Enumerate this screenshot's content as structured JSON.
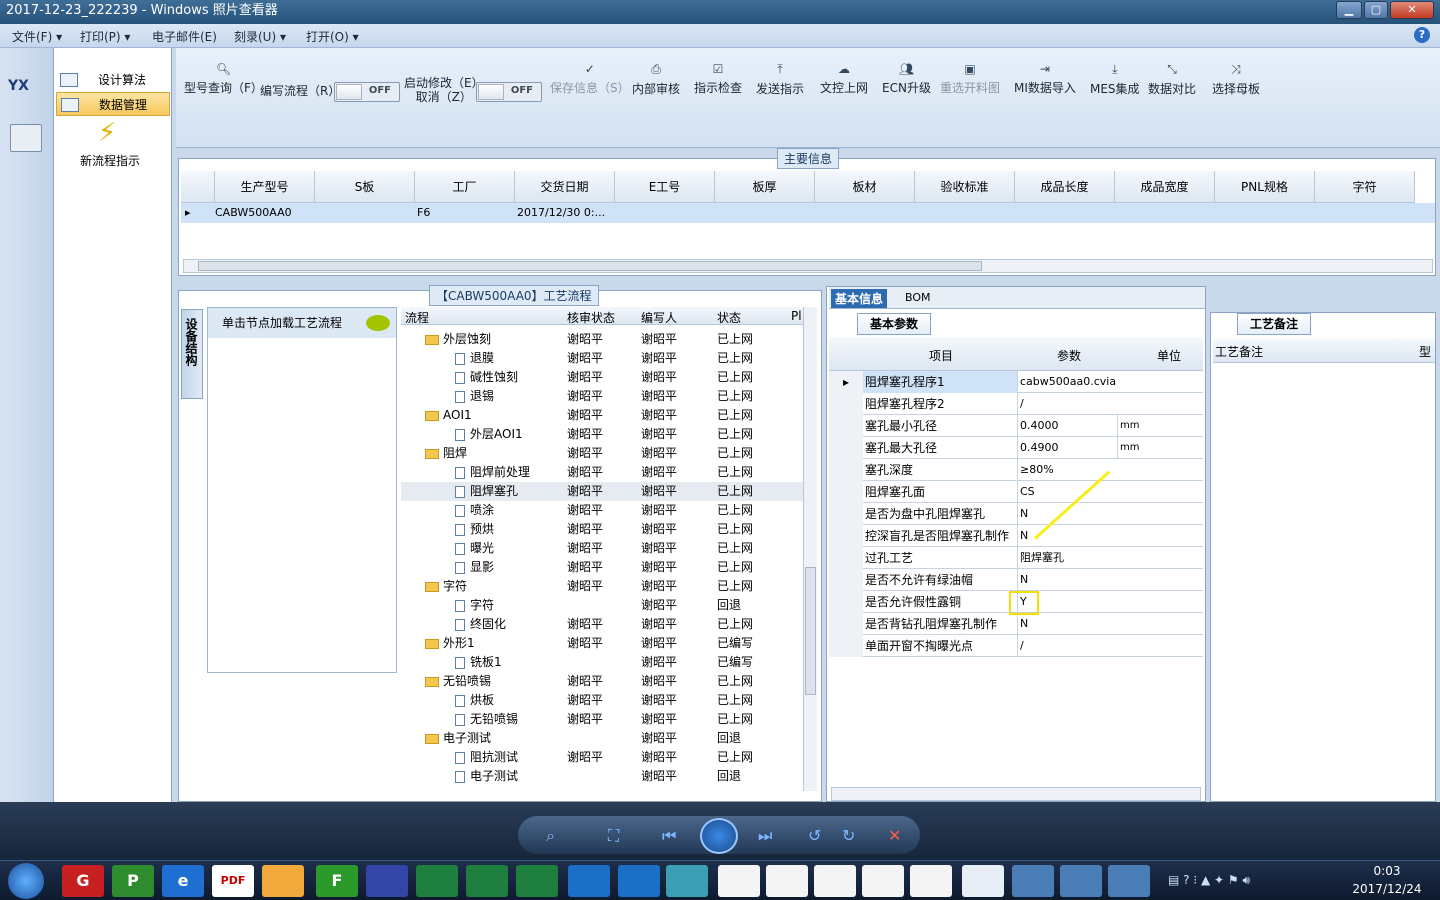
{
  "window": {
    "title": "2017-12-23_222239 - Windows 照片查看器",
    "min": "▁",
    "max": "▢",
    "close": "✕"
  },
  "menubar": {
    "items": [
      "文件(F) ▾",
      "打印(P) ▾",
      "电子邮件(E)",
      "刻录(U) ▾",
      "打开(O) ▾"
    ],
    "help": "?"
  },
  "left": {
    "logo": "YX"
  },
  "nav": {
    "items": [
      "设计算法",
      "数据管理"
    ],
    "action": "新流程指示"
  },
  "ribbon": {
    "buttons": [
      "型号查询（F）",
      "编写流程（R）",
      "启动修改（E）",
      "取消（Z）",
      "保存信息（S）",
      "内部审核",
      "指示检查",
      "发送指示",
      "文控上网",
      "ECN升级",
      "重选开料图",
      "MI数据导入",
      "MES集成",
      "数据对比",
      "选择母板"
    ],
    "toggle": "OFF"
  },
  "main": {
    "title": "主要信息",
    "columns": [
      "生产型号",
      "S板",
      "工厂",
      "交货日期",
      "E工号",
      "板厚",
      "板材",
      "验收标准",
      "成品长度",
      "成品宽度",
      "PNL规格",
      "字符"
    ],
    "row": {
      "model": "CABW500AA0",
      "factory": "F6",
      "date": "2017/12/30 0:..."
    }
  },
  "process": {
    "title": "【CABW500AA0】工艺流程",
    "side_tab": "设备结构",
    "hint": "单击节点加载工艺流程",
    "columns": [
      "流程",
      "核审状态",
      "编写人",
      "状态",
      "Pl"
    ],
    "rows": [
      {
        "n": "外层蚀刻",
        "f": 1,
        "a": "谢昭平",
        "w": "谢昭平",
        "s": "已上网"
      },
      {
        "n": "退膜",
        "f": 0,
        "a": "谢昭平",
        "w": "谢昭平",
        "s": "已上网"
      },
      {
        "n": "碱性蚀刻",
        "f": 0,
        "a": "谢昭平",
        "w": "谢昭平",
        "s": "已上网"
      },
      {
        "n": "退锡",
        "f": 0,
        "a": "谢昭平",
        "w": "谢昭平",
        "s": "已上网"
      },
      {
        "n": "AOI1",
        "f": 1,
        "a": "谢昭平",
        "w": "谢昭平",
        "s": "已上网"
      },
      {
        "n": "外层AOI1",
        "f": 0,
        "a": "谢昭平",
        "w": "谢昭平",
        "s": "已上网"
      },
      {
        "n": "阻焊",
        "f": 1,
        "a": "谢昭平",
        "w": "谢昭平",
        "s": "已上网"
      },
      {
        "n": "阻焊前处理",
        "f": 0,
        "a": "谢昭平",
        "w": "谢昭平",
        "s": "已上网"
      },
      {
        "n": "阻焊塞孔",
        "f": 0,
        "a": "谢昭平",
        "w": "谢昭平",
        "s": "已上网"
      },
      {
        "n": "喷涂",
        "f": 0,
        "a": "谢昭平",
        "w": "谢昭平",
        "s": "已上网"
      },
      {
        "n": "预烘",
        "f": 0,
        "a": "谢昭平",
        "w": "谢昭平",
        "s": "已上网"
      },
      {
        "n": "曝光",
        "f": 0,
        "a": "谢昭平",
        "w": "谢昭平",
        "s": "已上网"
      },
      {
        "n": "显影",
        "f": 0,
        "a": "谢昭平",
        "w": "谢昭平",
        "s": "已上网"
      },
      {
        "n": "字符",
        "f": 1,
        "a": "谢昭平",
        "w": "谢昭平",
        "s": "已上网"
      },
      {
        "n": "字符",
        "f": 0,
        "a": "",
        "w": "谢昭平",
        "s": "回退"
      },
      {
        "n": "终固化",
        "f": 0,
        "a": "谢昭平",
        "w": "谢昭平",
        "s": "已上网"
      },
      {
        "n": "外形1",
        "f": 1,
        "a": "谢昭平",
        "w": "谢昭平",
        "s": "已编写"
      },
      {
        "n": "铣板1",
        "f": 0,
        "a": "",
        "w": "谢昭平",
        "s": "已编写"
      },
      {
        "n": "无铅喷锡",
        "f": 1,
        "a": "谢昭平",
        "w": "谢昭平",
        "s": "已上网"
      },
      {
        "n": "烘板",
        "f": 0,
        "a": "谢昭平",
        "w": "谢昭平",
        "s": "已上网"
      },
      {
        "n": "无铅喷锡",
        "f": 0,
        "a": "谢昭平",
        "w": "谢昭平",
        "s": "已上网"
      },
      {
        "n": "电子测试",
        "f": 1,
        "a": "",
        "w": "谢昭平",
        "s": "回退"
      },
      {
        "n": "阻抗测试",
        "f": 0,
        "a": "谢昭平",
        "w": "谢昭平",
        "s": "已上网"
      },
      {
        "n": "电子测试",
        "f": 0,
        "a": "",
        "w": "谢昭平",
        "s": "回退"
      }
    ]
  },
  "info": {
    "tabs": [
      "基本信息",
      "BOM"
    ],
    "subtab": "基本参数",
    "columns": [
      "项目",
      "参数",
      "单位"
    ],
    "rows": [
      [
        "阻焊塞孔程序1",
        "cabw500aa0.cvia",
        ""
      ],
      [
        "阻焊塞孔程序2",
        "/",
        ""
      ],
      [
        "塞孔最小孔径",
        "0.4000",
        "mm"
      ],
      [
        "塞孔最大孔径",
        "0.4900",
        "mm"
      ],
      [
        "塞孔深度",
        "≥80%",
        ""
      ],
      [
        "阻焊塞孔面",
        "CS",
        ""
      ],
      [
        "是否为盘中孔阻焊塞孔",
        "N",
        ""
      ],
      [
        "控深盲孔是否阻焊塞孔制作",
        "N",
        ""
      ],
      [
        "过孔工艺",
        "阻焊塞孔",
        ""
      ],
      [
        "是否不允许有绿油帽",
        "N",
        ""
      ],
      [
        "是否允许假性露铜",
        "Y",
        ""
      ],
      [
        "是否背钻孔阻焊塞孔制作",
        "N",
        ""
      ],
      [
        "单面开窗不掏曝光点",
        "/",
        ""
      ]
    ]
  },
  "remark": {
    "tab": "工艺备注",
    "column": "工艺备注",
    "col2": "型"
  },
  "taskbar": {
    "time": "0:03",
    "date": "2017/12/24"
  }
}
